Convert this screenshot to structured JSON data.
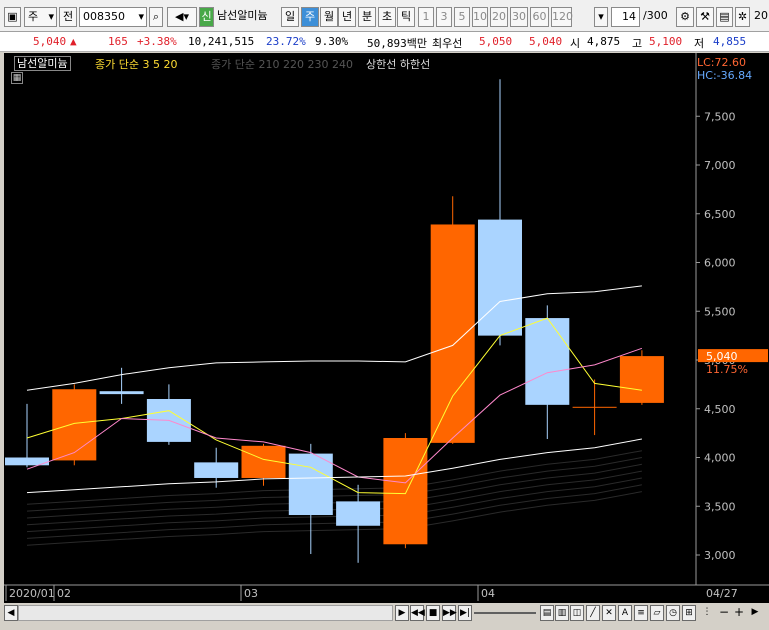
{
  "toolbar": {
    "market_label": "주",
    "prev_label": "전",
    "stock_code": "008350",
    "credit_badge": "신",
    "stock_name": "남선알미늄",
    "period_tabs": [
      {
        "label": "일",
        "selected": false
      },
      {
        "label": "주",
        "selected": true
      },
      {
        "label": "월",
        "selected": false
      },
      {
        "label": "년",
        "selected": false
      },
      {
        "label": "분",
        "selected": false
      },
      {
        "label": "초",
        "selected": false
      },
      {
        "label": "틱",
        "selected": false
      }
    ],
    "interval_buttons": [
      "1",
      "3",
      "5",
      "10",
      "20",
      "30",
      "60",
      "120"
    ],
    "count_value": "14",
    "count_max": "/300",
    "right_edge_text": "20"
  },
  "quote": {
    "price": "5,040",
    "direction_icon": "▲",
    "change": "165",
    "change_pct": "+3.38%",
    "volume": "10,241,515",
    "turnover_pct": "23.72%",
    "pct2": "9.30%",
    "amount": "50,893백만",
    "priority_label": "최우선",
    "ask": "5,050",
    "bid": "5,040",
    "open_label": "시",
    "open": "4,875",
    "high_label": "고",
    "high": "5,100",
    "low_label": "저",
    "low": "4,855"
  },
  "legend": {
    "name": "남선알미늄",
    "ma_price": "종가 단순 3 5 20",
    "ma_volume": "종가 단순 210 220 230 240",
    "limits": "상한선 하한선",
    "lc": "LC:72.60",
    "hc": "HC:-36.84"
  },
  "axis": {
    "y_ticks": [
      "7,500",
      "7,000",
      "6,500",
      "6,000",
      "5,500",
      "5,000",
      "4,500",
      "4,000",
      "3,500",
      "3,000"
    ],
    "current_price_label": "5,040",
    "current_pct_label": "11.75%",
    "x_labels": [
      "2020/01",
      "02",
      "03",
      "04"
    ],
    "x_end_label": "04/27"
  },
  "colors": {
    "up": "#ff6600",
    "down": "#aad4ff",
    "ma3": "#ffff33",
    "ma5": "#ff88cc",
    "ma20": "#ffffff",
    "background": "#000000",
    "axis_text": "#c0c0c0"
  },
  "chart_data": {
    "type": "candlestick",
    "x_labels": [
      "2020/01",
      "02",
      "03",
      "04"
    ],
    "x_end_label": "04/27",
    "ylim": [
      2800,
      7900
    ],
    "candles": [
      {
        "open": 4000,
        "high": 4550,
        "low": 3900,
        "close": 3920
      },
      {
        "open": 3970,
        "high": 4750,
        "low": 3920,
        "close": 4700
      },
      {
        "open": 4680,
        "high": 4920,
        "low": 4550,
        "close": 4650
      },
      {
        "open": 4600,
        "high": 4750,
        "low": 4130,
        "close": 4160
      },
      {
        "open": 3950,
        "high": 4100,
        "low": 3690,
        "close": 3790
      },
      {
        "open": 3790,
        "high": 4140,
        "low": 3710,
        "close": 4120
      },
      {
        "open": 4040,
        "high": 4140,
        "low": 3010,
        "close": 3410
      },
      {
        "open": 3550,
        "high": 3720,
        "low": 2920,
        "close": 3300
      },
      {
        "open": 3110,
        "high": 4250,
        "low": 3070,
        "close": 4200
      },
      {
        "open": 4150,
        "high": 6680,
        "low": 4140,
        "close": 6390
      },
      {
        "open": 6440,
        "high": 7880,
        "low": 5150,
        "close": 5250
      },
      {
        "open": 5430,
        "high": 5560,
        "low": 4190,
        "close": 4540
      },
      {
        "open": 4520,
        "high": 4800,
        "low": 4230,
        "close": 4520
      },
      {
        "open": 4560,
        "high": 5100,
        "low": 4540,
        "close": 5040
      }
    ],
    "series": [
      {
        "name": "3",
        "values": [
          4200,
          4350,
          4400,
          4480,
          4180,
          3980,
          3900,
          3640,
          3630,
          4630,
          5250,
          5430,
          4760,
          4690
        ]
      },
      {
        "name": "5",
        "values": [
          3880,
          4050,
          4400,
          4380,
          4200,
          4160,
          4050,
          3800,
          3740,
          4200,
          4640,
          4870,
          4950,
          5120
        ]
      },
      {
        "name": "20",
        "values": [
          4690,
          4760,
          4850,
          4920,
          4970,
          4980,
          4990,
          4990,
          4980,
          5150,
          5600,
          5680,
          5700,
          5760
        ]
      },
      {
        "name": "210",
        "values": [
          3640,
          3670,
          3700,
          3730,
          3750,
          3780,
          3790,
          3800,
          3810,
          3890,
          3980,
          4050,
          4100,
          4190
        ]
      }
    ]
  }
}
